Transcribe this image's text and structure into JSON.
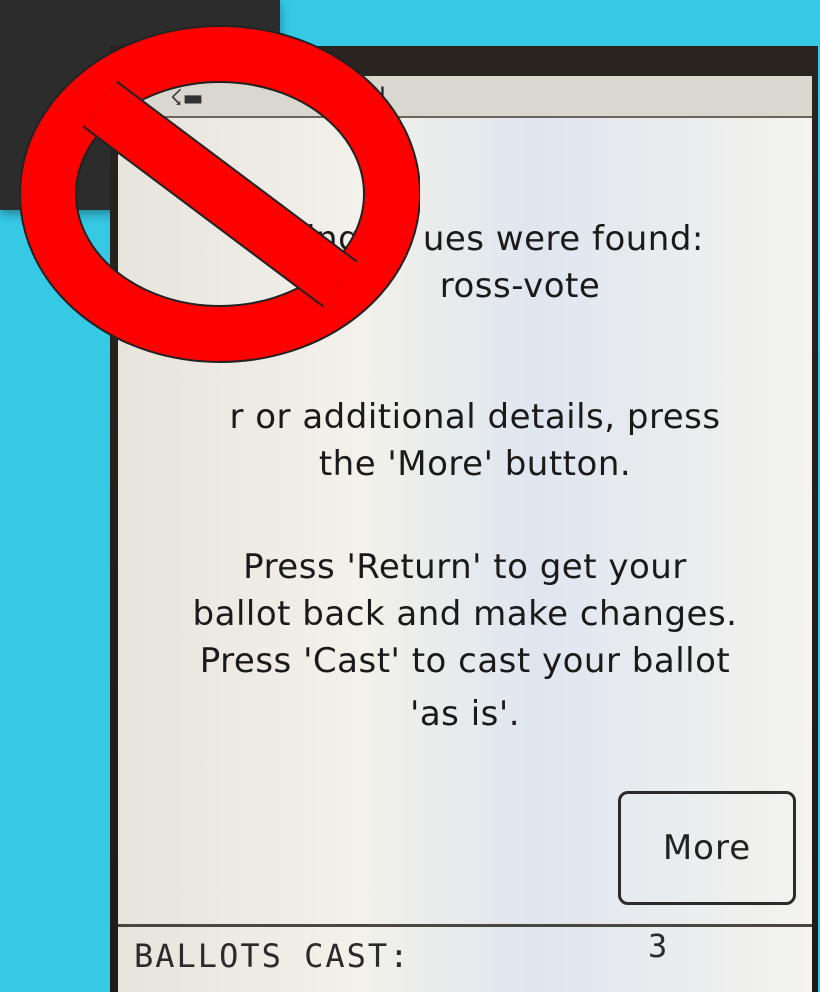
{
  "device": {
    "topbar_text": "N",
    "message": {
      "line_issues_a": "ing",
      "line_issues_b": "ues were found:",
      "line_crossvote": "ross-vote",
      "line_details_1": "r or additional details, press",
      "line_details_2": "the 'More' button.",
      "line_return_1": "Press 'Return' to get your",
      "line_return_2": "ballot back and make changes.",
      "line_cast": "Press 'Cast' to cast your ballot",
      "line_asis": "'as is'."
    },
    "more_button_label": "More",
    "status": {
      "label": "BALLOTS CAST:",
      "value": "3"
    }
  },
  "overlay": {
    "icon": "no-entry-sign",
    "color": "#ff0000"
  }
}
